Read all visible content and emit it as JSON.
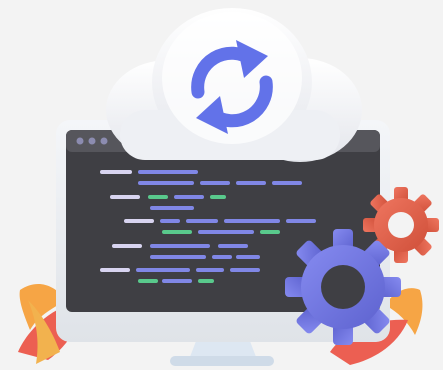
{
  "illustration": {
    "subject": "cloud-sync-monitor",
    "icons": [
      "cloud-icon",
      "sync-arrows-icon",
      "monitor-icon",
      "gear-large-icon",
      "gear-small-icon",
      "leaf-icon"
    ],
    "colors": {
      "background": "#f3f3f3",
      "cloud": "#ffffff",
      "sync_arrows": "#6272e9",
      "screen": "#3f3f44",
      "monitor_frame": "#ebeef2",
      "monitor_stand": "#dde7f2",
      "code_purple": "#8087e6",
      "code_green": "#59c98c",
      "code_light": "#d8d4f0",
      "gear_large": "#7277e0",
      "gear_small": "#e0634b",
      "leaf_red": "#ec5f52",
      "leaf_orange": "#f6a545"
    }
  }
}
